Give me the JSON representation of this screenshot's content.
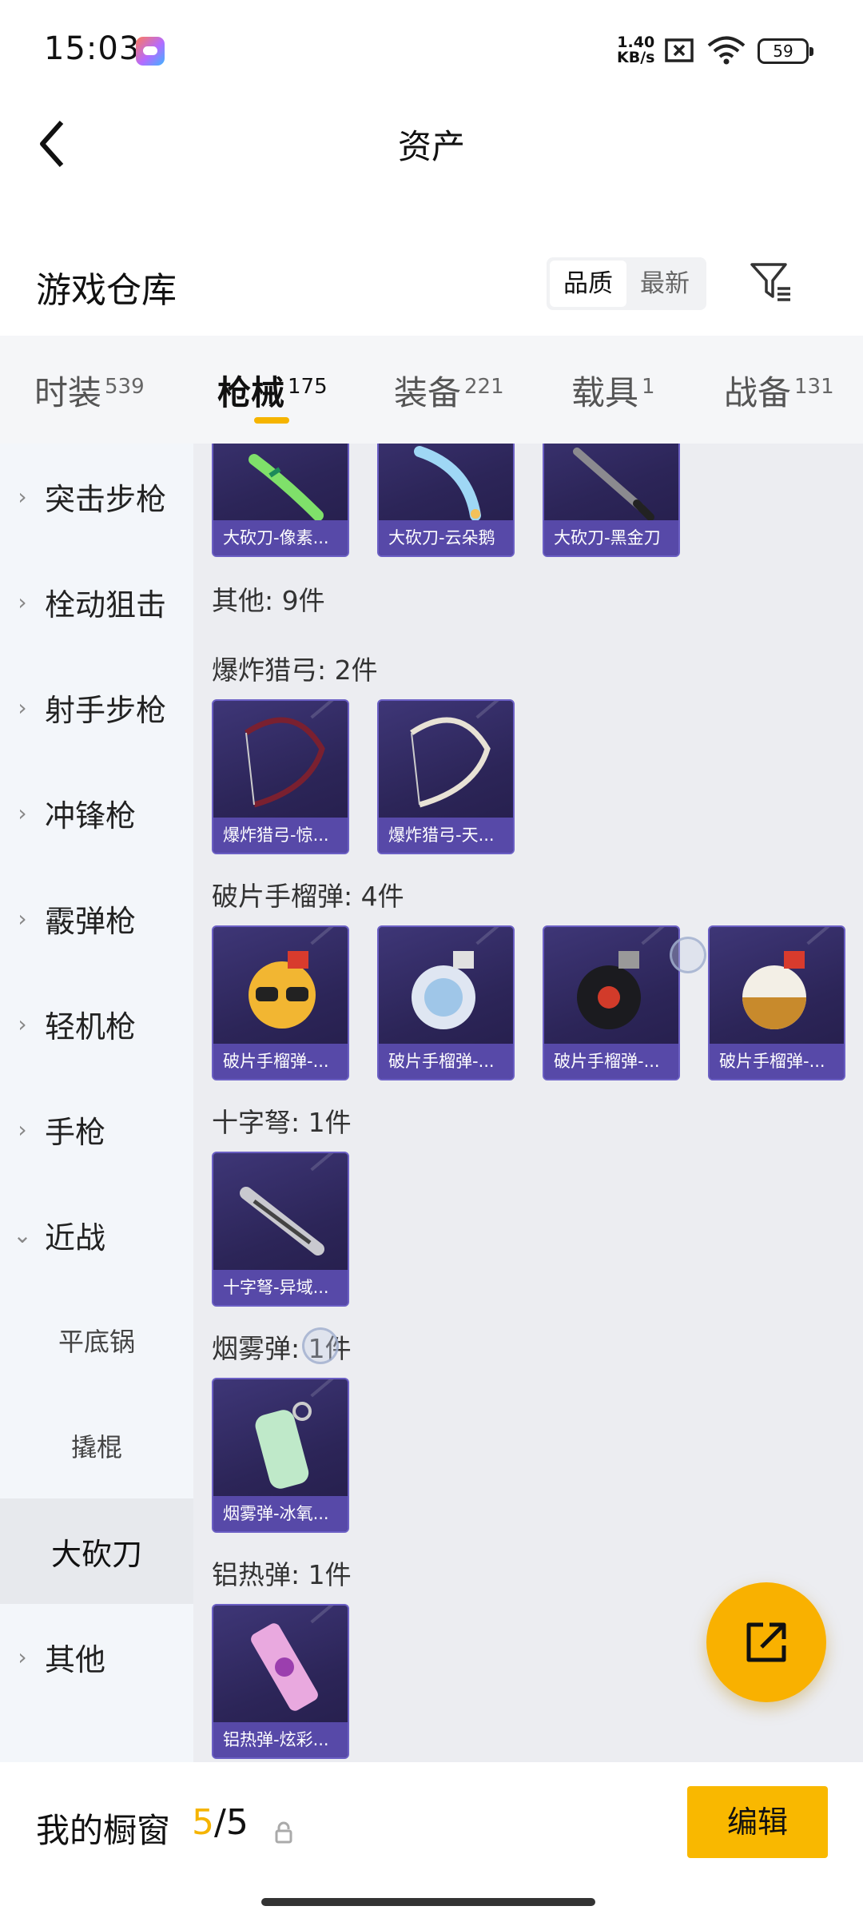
{
  "status_bar": {
    "time": "15:03",
    "speed_value": "1.40",
    "speed_unit": "KB/s",
    "battery": "59"
  },
  "header": {
    "title": "资产"
  },
  "section": {
    "title": "游戏仓库",
    "sort_options": [
      "品质",
      "最新"
    ],
    "active_sort": "品质"
  },
  "tabs": [
    {
      "label": "时装",
      "count": "539"
    },
    {
      "label": "枪械",
      "count": "175"
    },
    {
      "label": "装备",
      "count": "221"
    },
    {
      "label": "载具",
      "count": "1"
    },
    {
      "label": "战备",
      "count": "131"
    }
  ],
  "active_tab": "枪械",
  "sidebar": {
    "items": [
      "突击步枪",
      "栓动狙击",
      "射手步枪",
      "冲锋枪",
      "霰弹枪",
      "轻机枪",
      "手枪",
      "近战"
    ],
    "sub_items": [
      "平底锅",
      "撬棍",
      "大砍刀"
    ],
    "last_item": "其他",
    "active_sub": "大砍刀"
  },
  "content": {
    "top_cards": [
      "大砍刀-像素...",
      "大砍刀-云朵鹅",
      "大砍刀-黑金刀"
    ],
    "groups": [
      {
        "label": "其他: 9件",
        "cards": []
      },
      {
        "label": "爆炸猎弓: 2件",
        "cards": [
          "爆炸猎弓-惊...",
          "爆炸猎弓-天..."
        ]
      },
      {
        "label": "破片手榴弹: 4件",
        "cards": [
          "破片手榴弹-...",
          "破片手榴弹-...",
          "破片手榴弹-...",
          "破片手榴弹-..."
        ]
      },
      {
        "label": "十字弩: 1件",
        "cards": [
          "十字弩-异域..."
        ]
      },
      {
        "label": "烟雾弹: 1件",
        "cards": [
          "烟雾弹-冰氧..."
        ]
      },
      {
        "label": "铝热弹: 1件",
        "cards": [
          "铝热弹-炫彩..."
        ]
      }
    ]
  },
  "bottom_bar": {
    "label": "我的橱窗",
    "current": "5",
    "total": "/5",
    "edit_label": "编辑"
  },
  "colors": {
    "accent": "#f9b800",
    "card_bg": "#2c2558",
    "card_caption": "#5749a8"
  }
}
